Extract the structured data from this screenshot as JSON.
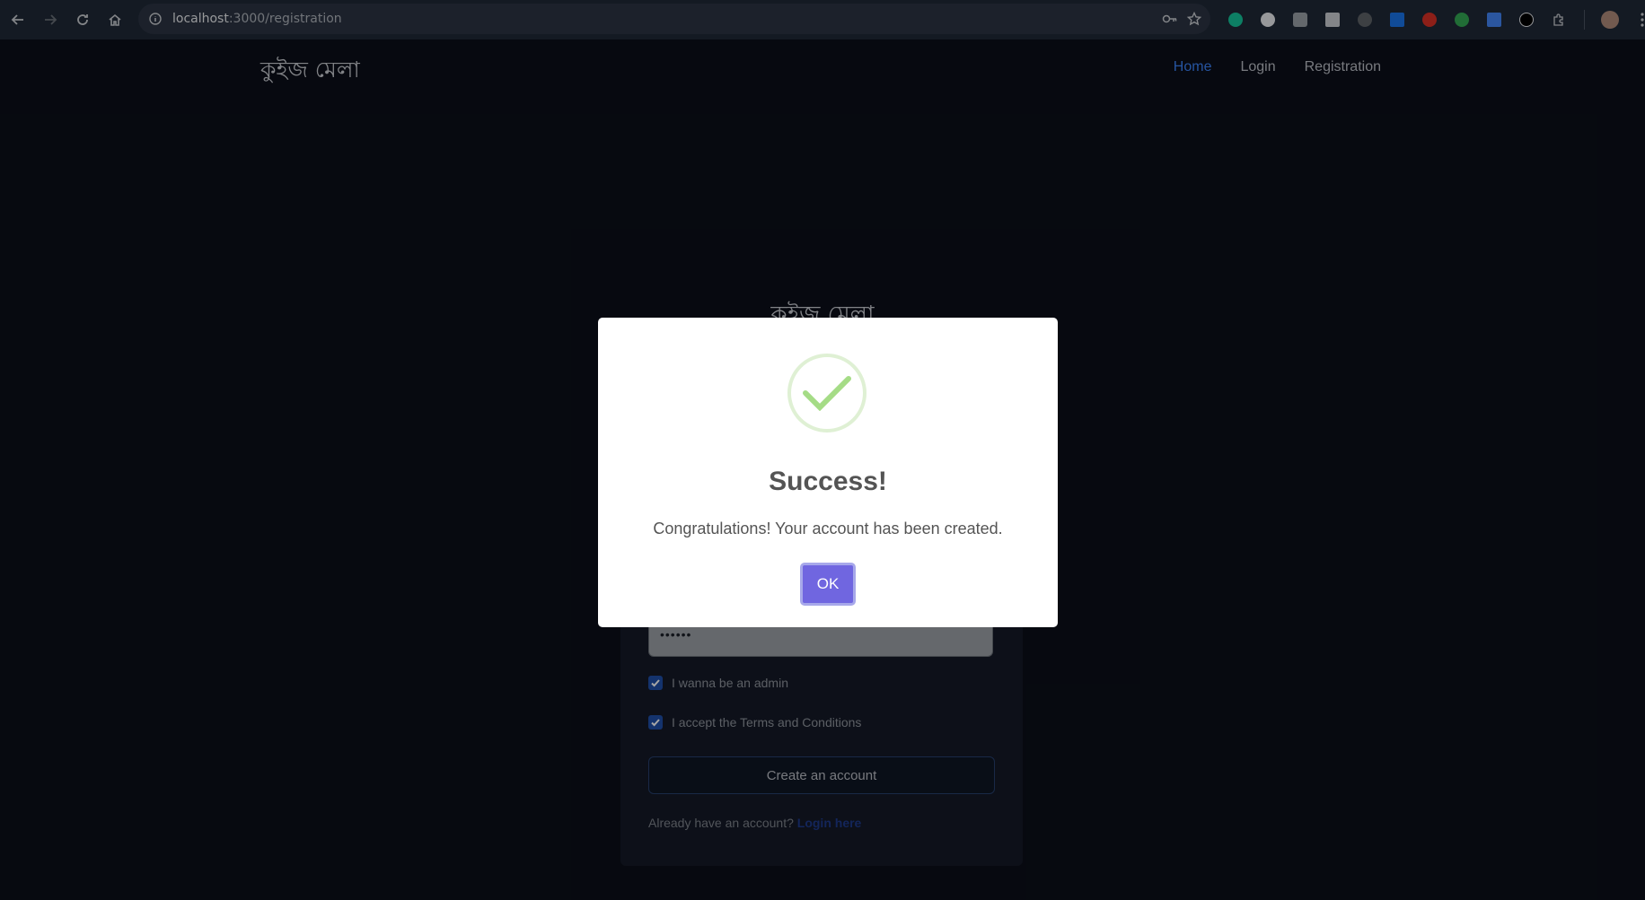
{
  "browser": {
    "url_host": "localhost",
    "url_path": ":3000/registration",
    "back_icon": "arrow-left-icon",
    "forward_icon": "arrow-right-icon",
    "reload_icon": "reload-icon",
    "home_icon": "home-icon"
  },
  "navbar": {
    "brand": "কুইজ মেলা",
    "links": [
      {
        "label": "Home",
        "active": true
      },
      {
        "label": "Login",
        "active": false
      },
      {
        "label": "Registration",
        "active": false
      }
    ]
  },
  "form": {
    "title": "কুইজ মেলা",
    "password_value": "••••••",
    "admin_checkbox_label": "I wanna be an admin",
    "admin_checked": true,
    "terms_checkbox_label": "I accept the Terms and Conditions",
    "terms_checked": true,
    "submit_label": "Create an account",
    "already_text": "Already have an account?",
    "login_link": "Login here"
  },
  "modal": {
    "icon": "success-check-icon",
    "title": "Success!",
    "text": "Congratulations! Your account has been created.",
    "ok_label": "OK"
  },
  "colors": {
    "page_bg": "#0b0f19",
    "accent_blue": "#3b82f6",
    "ok_button": "#7066e0",
    "success_check": "#a5dc86"
  }
}
